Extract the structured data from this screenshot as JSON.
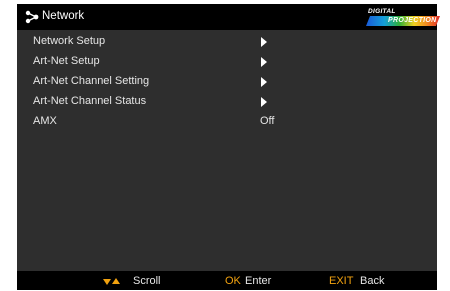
{
  "header": {
    "icon": "network-icon",
    "title": "Network",
    "logo": {
      "line1": "DIGITAL",
      "line2": "PROJECTION"
    }
  },
  "menu": {
    "items": [
      {
        "label": "Network Setup",
        "value": "",
        "submenu": true
      },
      {
        "label": "Art-Net Setup",
        "value": "",
        "submenu": true
      },
      {
        "label": "Art-Net Channel Setting",
        "value": "",
        "submenu": true
      },
      {
        "label": "Art-Net Channel Status",
        "value": "",
        "submenu": true
      },
      {
        "label": "AMX",
        "value": "Off",
        "submenu": false
      }
    ]
  },
  "footer": {
    "scroll_icon": "up-down-arrows-icon",
    "scroll_label": "Scroll",
    "ok_key": "OK",
    "ok_label": "Enter",
    "exit_key": "EXIT",
    "exit_label": "Back"
  },
  "colors": {
    "panel": "#2e2e2e",
    "bar": "#000000",
    "key_accent": "#f2a20f",
    "text": "#e6e6e6"
  }
}
